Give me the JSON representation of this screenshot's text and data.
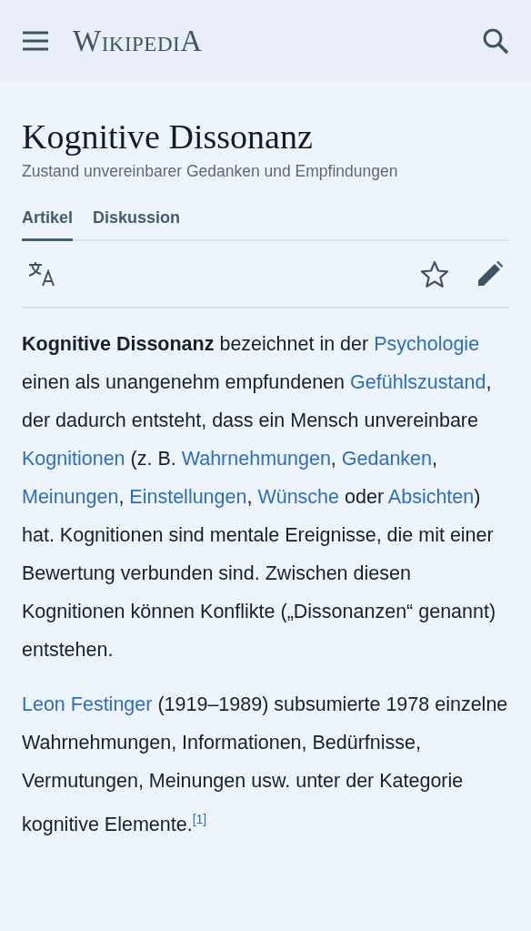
{
  "header": {
    "logo": "WikipediA"
  },
  "article": {
    "title": "Kognitive Dissonanz",
    "subtitle": "Zustand unvereinbarer Gedanken und Empfindungen"
  },
  "tabs": [
    {
      "label": "Artikel",
      "selected": true
    },
    {
      "label": "Diskussion",
      "selected": false
    }
  ],
  "toolbar": {
    "watched": false
  },
  "paragraphs": [
    [
      {
        "kind": "bold",
        "text": "Kognitive Dissonanz"
      },
      {
        "kind": "text",
        "text": " bezeichnet in der "
      },
      {
        "kind": "link",
        "text": "Psychologie"
      },
      {
        "kind": "text",
        "text": " einen als unangenehm empfundenen "
      },
      {
        "kind": "link",
        "text": "Gefühlszustand"
      },
      {
        "kind": "text",
        "text": ", der dadurch entsteht, dass ein Mensch unvereinbare "
      },
      {
        "kind": "link",
        "text": "Kognitionen"
      },
      {
        "kind": "text",
        "text": " (z. B. "
      },
      {
        "kind": "link",
        "text": "Wahrnehmungen"
      },
      {
        "kind": "text",
        "text": ", "
      },
      {
        "kind": "link",
        "text": "Gedanken"
      },
      {
        "kind": "text",
        "text": ", "
      },
      {
        "kind": "link",
        "text": "Meinungen"
      },
      {
        "kind": "text",
        "text": ", "
      },
      {
        "kind": "link",
        "text": "Einstellungen"
      },
      {
        "kind": "text",
        "text": ", "
      },
      {
        "kind": "link",
        "text": "Wünsche"
      },
      {
        "kind": "text",
        "text": " oder "
      },
      {
        "kind": "link",
        "text": "Absichten"
      },
      {
        "kind": "text",
        "text": ") hat. Kognitionen sind mentale Ereignisse, die mit einer Bewertung verbunden sind. Zwischen diesen Kognitionen können Konflikte („Dissonanzen“ genannt) entstehen."
      }
    ],
    [
      {
        "kind": "link",
        "text": "Leon Festinger"
      },
      {
        "kind": "text",
        "text": " (1919–1989) subsumierte 1978 einzelne Wahrnehmungen, Informationen, Bedürfnisse, Vermutungen, Meinungen usw. unter der Kategorie kognitive Elemente."
      },
      {
        "kind": "ref",
        "text": "[1]"
      }
    ]
  ]
}
